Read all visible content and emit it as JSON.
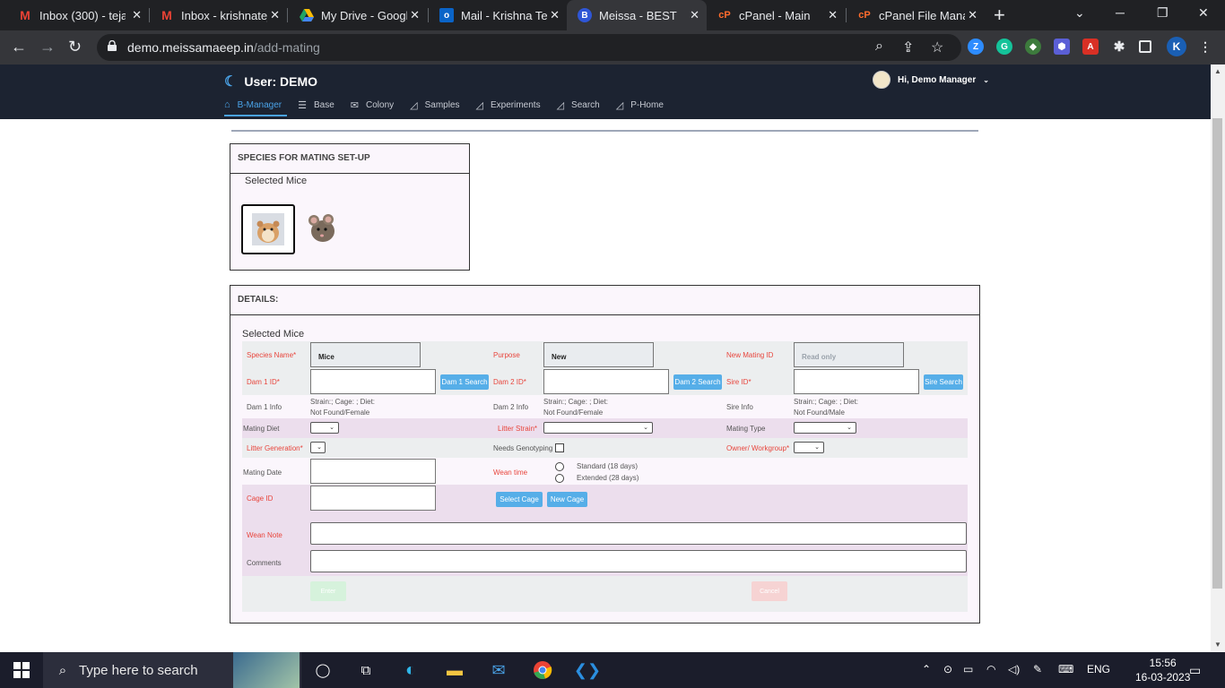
{
  "browser": {
    "tabs": [
      {
        "title": "Inbox (300) - teja",
        "icon": "gmail-icon",
        "color": "#ea4335",
        "glyph": "M"
      },
      {
        "title": "Inbox - krishnatej",
        "icon": "gmail-icon",
        "color": "#ea4335",
        "glyph": "M"
      },
      {
        "title": "My Drive - Googl",
        "icon": "google-drive-icon",
        "color": "#1fa463",
        "glyph": "▲"
      },
      {
        "title": "Mail - Krishna Tej",
        "icon": "outlook-icon",
        "color": "#0a64c8",
        "glyph": "o"
      },
      {
        "title": "Meissa - BEST",
        "icon": "meissa-icon",
        "color": "#2f56d6",
        "glyph": "B"
      },
      {
        "title": "cPanel - Main",
        "icon": "cpanel-icon",
        "color": "#ff6c2c",
        "glyph": "cP"
      },
      {
        "title": "cPanel File Manag",
        "icon": "cpanel-icon",
        "color": "#ff6c2c",
        "glyph": "cP"
      }
    ],
    "url_host": "demo.meissamaeep.in",
    "url_path": "/add-mating",
    "profile_initial": "K"
  },
  "header": {
    "user_label": "User: DEMO",
    "greeting": "Hi, Demo Manager",
    "nav": [
      {
        "label": "B-Manager",
        "icon": "home-icon"
      },
      {
        "label": "Base",
        "icon": "list-icon"
      },
      {
        "label": "Colony",
        "icon": "envelope-icon"
      },
      {
        "label": "Samples",
        "icon": "chart-icon"
      },
      {
        "label": "Experiments",
        "icon": "chart-icon"
      },
      {
        "label": "Search",
        "icon": "chart-icon"
      },
      {
        "label": "P-Home",
        "icon": "chart-icon"
      }
    ]
  },
  "species_card": {
    "title": "SPECIES FOR MATING SET-UP",
    "subtitle": "Selected Mice"
  },
  "details": {
    "title": "DETAILS:",
    "subtitle": "Selected Mice",
    "species_label": "Species Name*",
    "species_value": "Mice",
    "purpose_label": "Purpose",
    "purpose_value": "New",
    "new_mating_label": "New Mating ID",
    "new_mating_value": "Read only",
    "dam1_label": "Dam 1 ID*",
    "dam1_btn": "Dam 1 Search",
    "dam2_label": "Dam 2 ID*",
    "dam2_btn": "Dam 2 Search",
    "sire_label": "Sire ID*",
    "sire_btn": "Sire Search",
    "dam1_info_label": "Dam 1 Info",
    "dam1_info_l1": "Strain:; Cage: ; Diet:",
    "dam1_info_l2": "Not Found/Female",
    "dam2_info_label": "Dam 2 Info",
    "dam2_info_l1": "Strain:; Cage: ; Diet:",
    "dam2_info_l2": "Not Found/Female",
    "sire_info_label": "Sire Info",
    "sire_info_l1": "Strain:; Cage: ; Diet:",
    "sire_info_l2": "Not Found/Male",
    "mating_diet_label": "Mating Diet",
    "litter_strain_label": "Litter Strain*",
    "mating_type_label": "Mating Type",
    "litter_gen_label": "Litter Generation*",
    "genotyping_label": "Needs Genotyping",
    "owner_label": "Owner/ Workgroup*",
    "mating_date_label": "Mating Date",
    "wean_time_label": "Wean time",
    "wean_standard": "Standard (18 days)",
    "wean_extended": "Extended (28 days)",
    "cage_label": "Cage ID",
    "select_cage_btn": "Select Cage",
    "new_cage_btn": "New Cage",
    "wean_note_label": "Wean Note",
    "comments_label": "Comments",
    "enter_btn": "Enter",
    "cancel_btn": "Cancel"
  },
  "taskbar": {
    "search_placeholder": "Type here to search",
    "lang": "ENG",
    "time": "15:56",
    "date": "16-03-2023"
  }
}
